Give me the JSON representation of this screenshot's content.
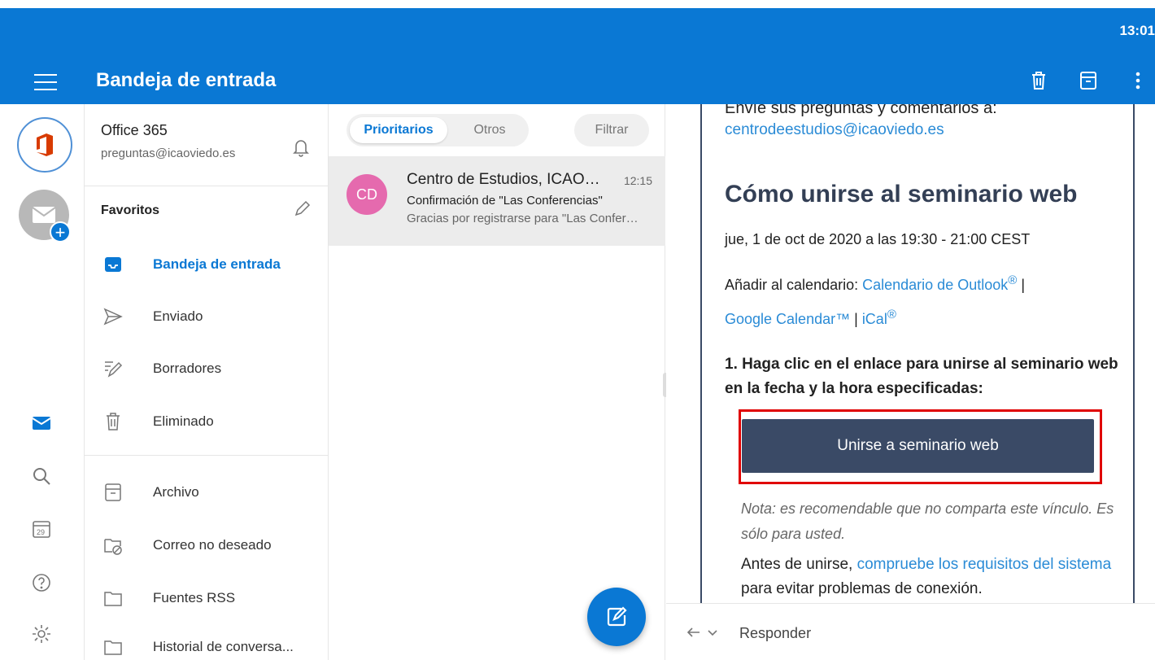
{
  "status": {
    "time": "13:01"
  },
  "header": {
    "title": "Bandeja de entrada",
    "icons": [
      "menu-icon",
      "trash-icon",
      "archive-icon",
      "more-icon"
    ]
  },
  "account": {
    "name": "Office 365",
    "email": "preguntas@icaoviedo.es"
  },
  "favorites": {
    "header": "Favoritos"
  },
  "folders": [
    {
      "label": "Bandeja de entrada",
      "icon": "inbox-icon",
      "active": true
    },
    {
      "label": "Enviado",
      "icon": "sent-icon"
    },
    {
      "label": "Borradores",
      "icon": "drafts-icon"
    },
    {
      "label": "Eliminado",
      "icon": "trash-icon"
    },
    {
      "label": "Archivo",
      "icon": "archive-icon"
    },
    {
      "label": "Correo no deseado",
      "icon": "junk-icon"
    },
    {
      "label": "Fuentes RSS",
      "icon": "folder-icon"
    },
    {
      "label": "Historial de conversa...",
      "icon": "folder-icon"
    }
  ],
  "list": {
    "tab_focused": "Prioritarios",
    "tab_other": "Otros",
    "filter": "Filtrar",
    "messages": [
      {
        "avatar": "CD",
        "sender": "Centro de Estudios, ICAOviedo",
        "time": "12:15",
        "subject": "Confirmación de \"Las Conferencias\"",
        "preview": "Gracias por registrarse para \"Las Conferencias\""
      }
    ]
  },
  "reading": {
    "intro_cut": "Envíe sus preguntas y comentarios a:",
    "contact_email": "centrodeestudios@icaoviedo.es",
    "heading": "Cómo unirse al seminario web",
    "date": "jue, 1 de oct de 2020 a las 19:30 - 21:00 CEST",
    "add_calendar": "Añadir al calendario:",
    "outlook_cal": "Calendario de Outlook",
    "reg_mark": "®",
    "sep": "|",
    "google_cal": "Google Calendar™",
    "ical": "iCal",
    "step1": "1. Haga clic en el enlace para unirse al seminario web en la fecha y la hora especificadas:",
    "join_button": "Unirse a seminario web",
    "note": "Nota: es recomendable que no comparta este vínculo. Es sólo para usted.",
    "before_text": "Antes de unirse,",
    "req_link": "compruebe los requisitos del sistema",
    "after_text": "para evitar problemas de conexión."
  },
  "reply": {
    "label": "Responder"
  },
  "colors": {
    "brand": "#0a78d4",
    "email_accent": "#3a4a66",
    "highlight": "#e00000",
    "avatar": "#e56aae"
  }
}
